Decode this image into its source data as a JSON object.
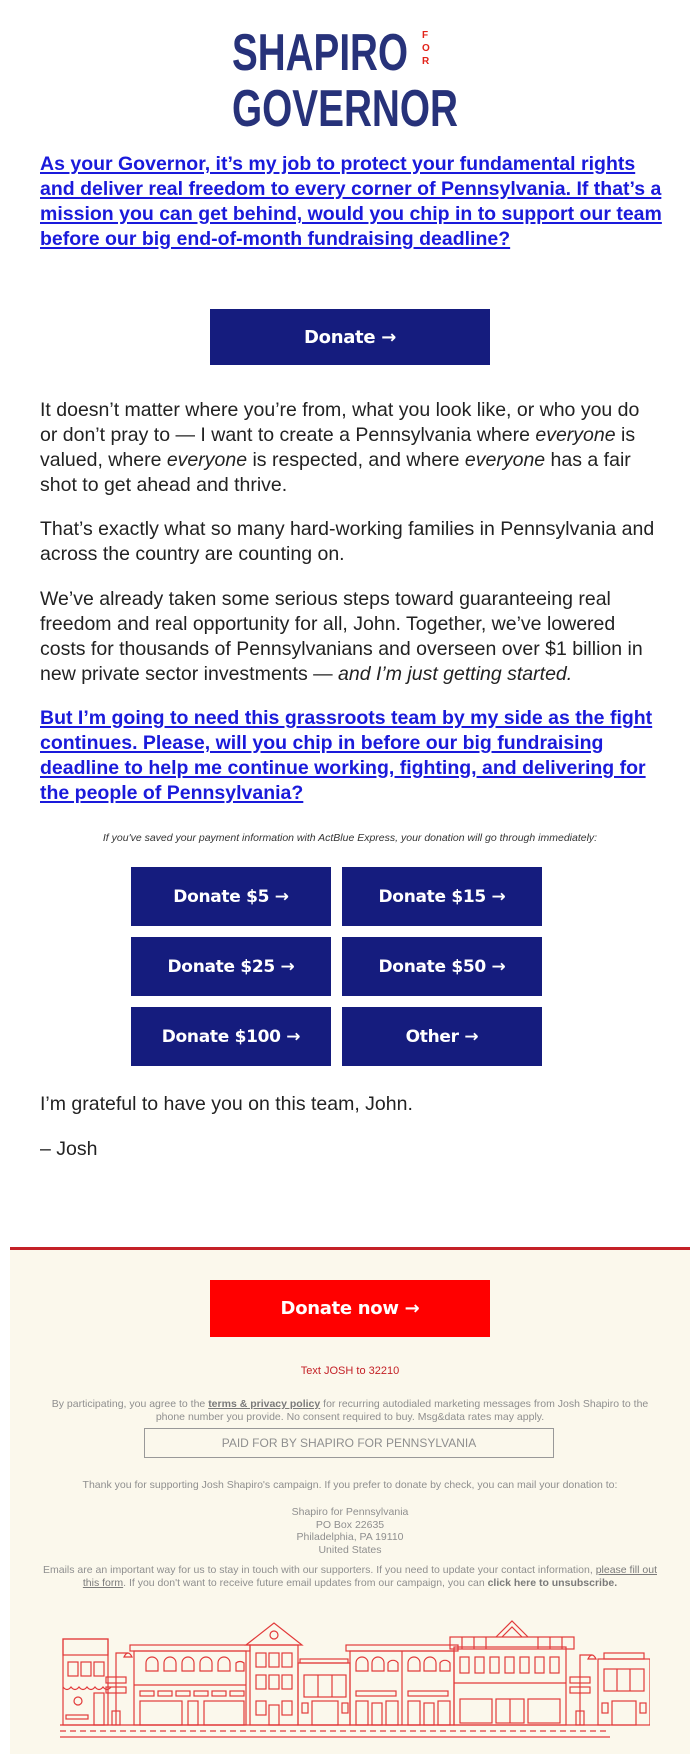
{
  "brand": {
    "line1": "SHAPIRO",
    "line2": "GOVERNOR",
    "for": "FOR",
    "navy": "#27327a",
    "red": "#e2231a"
  },
  "intro_link": "As your Governor, it’s my job to protect your fundamental rights and deliver real freedom to every corner of Pennsylvania. If that’s a mission you can get behind, would you chip in to support our team before our big end-of-month fundraising deadline?",
  "main_donate_label": "Donate →",
  "body": {
    "p1": {
      "t1": "It doesn’t matter where you’re from, what you look like, or who you do or don’t pray to — I want to create a Pennsylvania where ",
      "em1": "everyone",
      "t2": " is valued, where ",
      "em2": "everyone",
      "t3": " is respected, and where ",
      "em3": "everyone",
      "t4": " has a fair shot to get ahead and thrive."
    },
    "p2": "That’s exactly what so many hard-working families in Pennsylvania and across the country are counting on.",
    "p3": {
      "text": "We’ve already taken some serious steps toward guaranteeing real freedom and real opportunity for all, John. Together, we’ve lowered costs for thousands of Pennsylvanians and overseen over $1 billion in new private sector investments — ",
      "em": "and I’m just getting started."
    }
  },
  "appeal_link": "But I’m going to need this grassroots team by my side as the fight continues. Please, will you chip in before our big fundraising deadline to help me continue working, fighting, and delivering for the people of Pennsylvania?",
  "express_note": "If you've saved your payment information with ActBlue Express, your donation will go through immediately:",
  "donation_buttons": [
    {
      "label": "Donate $5 →"
    },
    {
      "label": "Donate $15 →"
    },
    {
      "label": "Donate $25 →"
    },
    {
      "label": "Donate $50 →"
    },
    {
      "label": "Donate $100 →"
    },
    {
      "label": "Other →"
    }
  ],
  "closing": "I’m grateful to have you on this team, John.",
  "signature": "– Josh",
  "footer": {
    "donate_now_label": "Donate now →",
    "text_cta": "Text JOSH to 32210",
    "sms_legal": {
      "before": "By participating, you agree to the ",
      "link": "terms & privacy policy",
      "after": " for recurring autodialed marketing messages from Josh Shapiro to the phone number you provide. No consent required to buy. Msg&data rates may apply."
    },
    "paid_for": "PAID FOR BY SHAPIRO FOR PENNSYLVANIA",
    "check_note": "Thank you for supporting Josh Shapiro's campaign. If you prefer to donate by check, you can mail your donation to:",
    "address": [
      "Shapiro for Pennsylvania",
      "PO Box 22635",
      "Philadelphia, PA 19110",
      "United States"
    ],
    "email_note": {
      "before": "Emails are an important way for us to stay in touch with our supporters. If you need to update your contact information, ",
      "form_link": "please fill out this form",
      "middle": ". If you don't want to receive future email updates from our campaign, you can ",
      "unsub_link": "click here to unsubscribe."
    },
    "bg_color": "#fbf8ec",
    "rule_color": "#c42127"
  },
  "colors": {
    "button_navy": "#151c7e",
    "button_red": "#ff0000",
    "link_blue": "#1a1adb"
  }
}
